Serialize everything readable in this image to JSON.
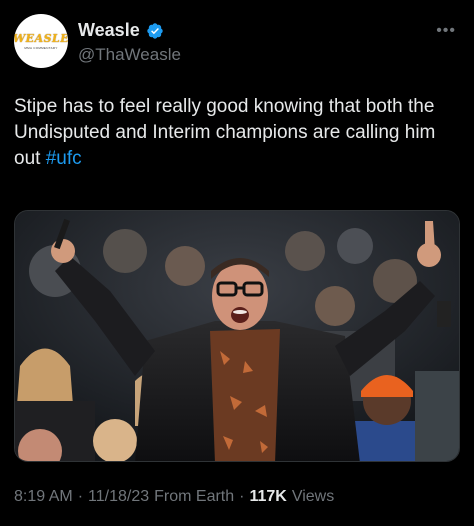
{
  "author": {
    "display_name": "Weasle",
    "handle": "@ThaWeasle",
    "avatar_logo": "WEASLE",
    "avatar_sub": "MMA COMMENTARY",
    "verified_color": "#1d9bf0"
  },
  "more_icon": "more-horizontal-icon",
  "tweet": {
    "text": "Stipe has to feel really good knowing that both the Undisputed and Interim champions are calling him out",
    "hashtag": "#ufc"
  },
  "meta": {
    "time": "8:19 AM",
    "date": "11/18/23",
    "source": "From Earth",
    "views_count": "117K",
    "views_label": "Views"
  },
  "colors": {
    "background": "#000000",
    "text": "#e7e9ea",
    "secondary": "#71767b",
    "accent": "#1d9bf0"
  }
}
